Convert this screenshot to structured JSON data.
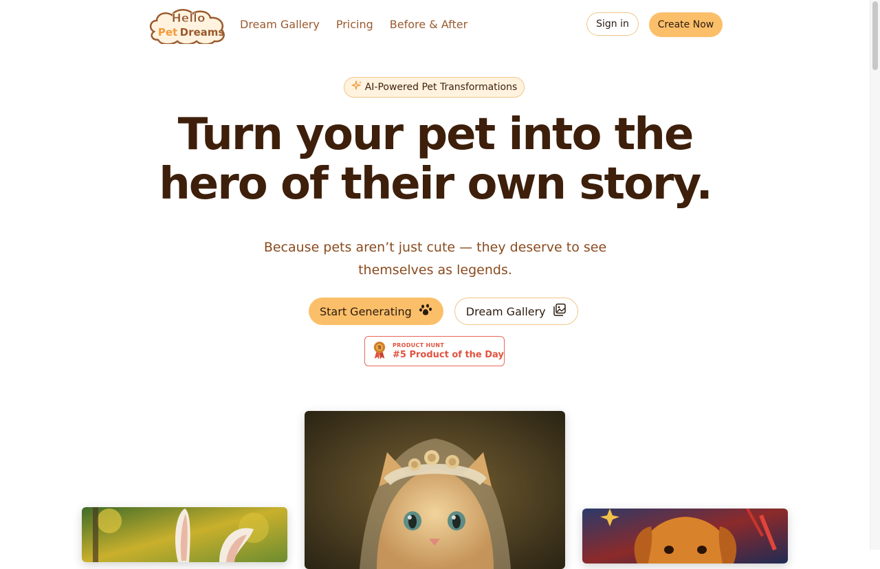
{
  "logo": {
    "line1": "Hello",
    "line2a": "Pet",
    "line2b": "Dreams"
  },
  "nav": {
    "items": [
      "Dream Gallery",
      "Pricing",
      "Before & After"
    ],
    "sign_in": "Sign in",
    "create_now": "Create Now"
  },
  "hero": {
    "badge": "AI-Powered Pet Transformations",
    "headline_line1": "Turn your pet into the",
    "headline_line2": "hero of their own story.",
    "subtitle": "Because pets aren’t just cute — they deserve to see themselves as legends.",
    "cta_primary": "Start Generating",
    "cta_secondary": "Dream Gallery"
  },
  "product_hunt": {
    "label": "PRODUCT HUNT",
    "title": "#5 Product of the Day",
    "rank": "5"
  },
  "colors": {
    "brand_brown": "#3d1f0b",
    "nav_text": "#9a5a2e",
    "accent_orange": "#fbbf6a",
    "accent_border": "#f0c58a",
    "product_hunt_red": "#e0533f"
  },
  "icons": {
    "badge": "sparkles-icon",
    "cta_primary": "paw-icon",
    "cta_secondary": "gallery-icon",
    "product_hunt": "medal-icon"
  }
}
